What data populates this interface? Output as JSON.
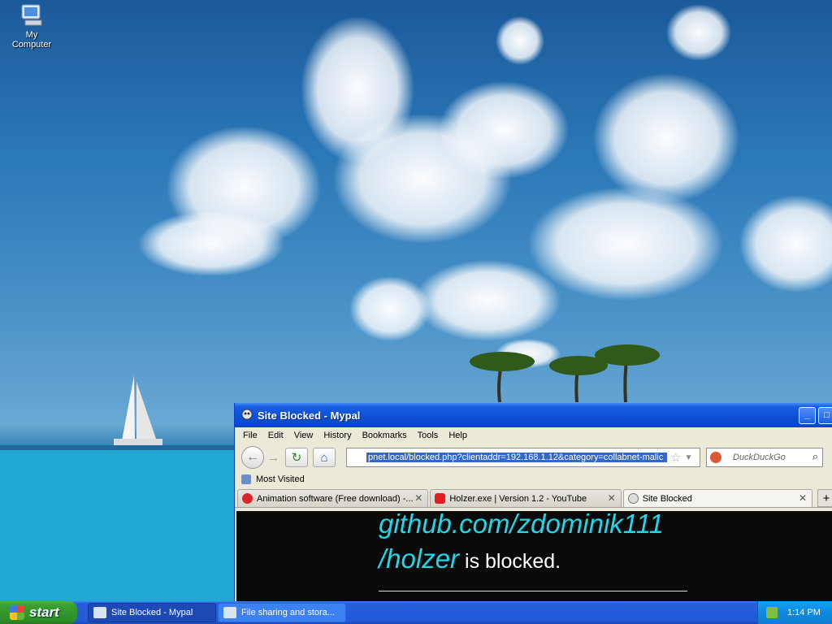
{
  "desktop": {
    "icons": [
      {
        "label": "My Computer",
        "icon": "computer-icon"
      }
    ]
  },
  "window": {
    "title": "Site Blocked - Mypal",
    "controls": {
      "minimize": "_",
      "maximize": "□"
    },
    "menu": [
      "File",
      "Edit",
      "View",
      "History",
      "Bookmarks",
      "Tools",
      "Help"
    ],
    "url": "pnet.local/blocked.php?clientaddr=192.168.1.12&category=collabnet-malic",
    "search_placeholder": "DuckDuckGo",
    "bookmarks_toolbar": {
      "label": "Most Visited"
    },
    "tabs": [
      {
        "label": "Animation software (Free download) -...",
        "active": false
      },
      {
        "label": "Holzer.exe | Version 1.2 - YouTube",
        "active": false
      },
      {
        "label": "Site Blocked",
        "active": true
      }
    ],
    "page": {
      "line1": "github.com/zdominik111",
      "line2_url": "/holzer",
      "line2_text": " is blocked."
    }
  },
  "taskbar": {
    "start_label": "start",
    "tasks": [
      {
        "label": "Site Blocked - Mypal",
        "active": true
      },
      {
        "label": "File sharing and stora...",
        "active": false
      }
    ],
    "clock": "1:14 PM"
  },
  "colors": {
    "blocked_link": "#20d7e7",
    "taskbar": "#225ad8",
    "titlebar": "#0b4fd6"
  }
}
